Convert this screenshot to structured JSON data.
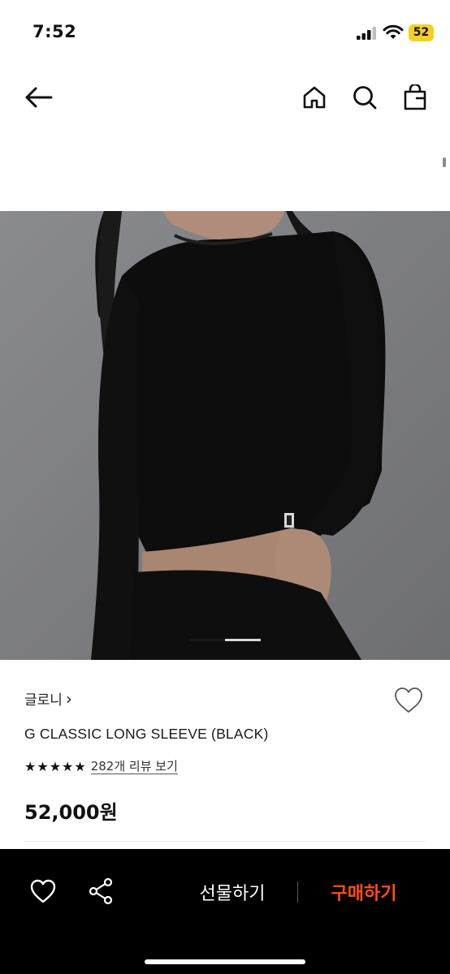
{
  "status_bar": {
    "time": "7:52",
    "battery": "52",
    "battery_color": "#f5d020"
  },
  "nav": {
    "icons": [
      "back-arrow-icon",
      "home-icon",
      "search-icon",
      "shopping-bag-icon"
    ]
  },
  "product": {
    "brand": "글로니",
    "brand_chevron": "›",
    "name": "G CLASSIC LONG SLEEVE (BLACK)",
    "rating_stars": 5,
    "review_link": "282개 리뷰 보기",
    "price": "52,000원",
    "image_index": 1,
    "image_count": 2
  },
  "bottom_bar": {
    "gift_label": "선물하기",
    "buy_label": "구매하기",
    "buy_color": "#ff4f0f"
  }
}
